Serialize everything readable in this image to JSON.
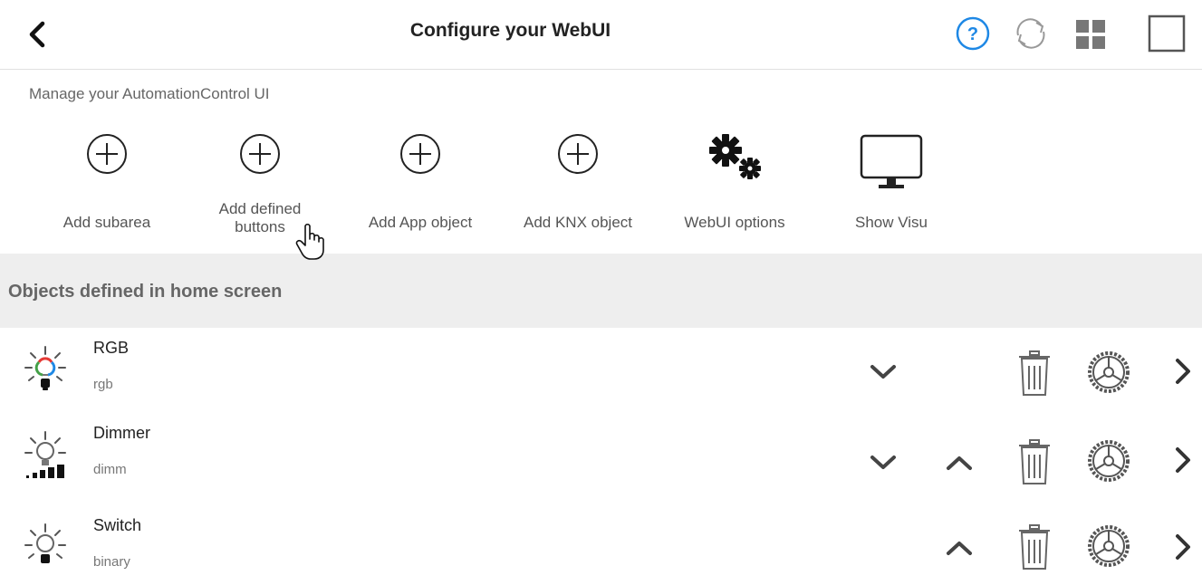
{
  "header": {
    "title": "Configure your WebUI",
    "back_icon": "chevron-left-icon",
    "help_icon": "help-circle-icon",
    "refresh_icon": "refresh-icon",
    "grid_icon": "grid-icon",
    "fullscreen_icon": "square-icon",
    "accent_color": "#1e88e5"
  },
  "subtitle": "Manage your AutomationControl UI",
  "toolbar": {
    "items": [
      {
        "label": "Add subarea",
        "icon": "plus-circle-icon"
      },
      {
        "label": "Add defined buttons",
        "icon": "plus-circle-icon"
      },
      {
        "label": "Add App object",
        "icon": "plus-circle-icon"
      },
      {
        "label": "Add KNX object",
        "icon": "plus-circle-icon"
      },
      {
        "label": "WebUI options",
        "icon": "gears-icon"
      },
      {
        "label": "Show Visu",
        "icon": "monitor-icon"
      }
    ]
  },
  "section": {
    "title": "Objects defined in home screen"
  },
  "objects": [
    {
      "name": "RGB",
      "type": "rgb",
      "icon": "rgb-bulb-icon",
      "move_down": true,
      "move_up": false
    },
    {
      "name": "Dimmer",
      "type": "dimm",
      "icon": "dimmer-bulb-icon",
      "move_down": true,
      "move_up": true
    },
    {
      "name": "Switch",
      "type": "binary",
      "icon": "bulb-icon",
      "move_down": false,
      "move_up": true
    }
  ]
}
